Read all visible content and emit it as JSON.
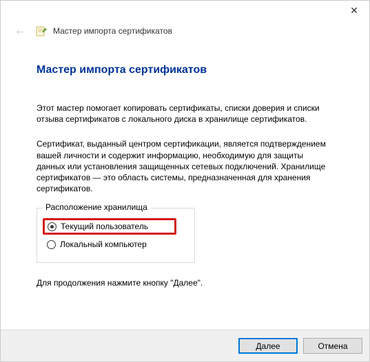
{
  "window": {
    "close_glyph": "✕"
  },
  "header": {
    "back_arrow": "←",
    "title": "Мастер импорта сертификатов"
  },
  "page": {
    "title": "Мастер импорта сертификатов",
    "intro": "Этот мастер помогает копировать сертификаты, списки доверия и списки отзыва сертификатов с локального диска в хранилище сертификатов.",
    "desc": "Сертификат, выданный центром сертификации, является подтверждением вашей личности и содержит информацию, необходимую для защиты данных или установления защищенных сетевых подключений. Хранилище сертификатов — это область системы, предназначенная для хранения сертификатов.",
    "continue": "Для продолжения нажмите кнопку \"Далее\"."
  },
  "storage": {
    "legend": "Расположение хранилища",
    "options": [
      {
        "label": "Текущий пользователь",
        "checked": true
      },
      {
        "label": "Локальный компьютер",
        "checked": false
      }
    ]
  },
  "footer": {
    "next": "Далее",
    "cancel": "Отмена"
  },
  "colors": {
    "title": "#003399",
    "highlight_border": "#d41616",
    "footer_bg": "#f0f0f0",
    "primary_border": "#0078d7"
  }
}
